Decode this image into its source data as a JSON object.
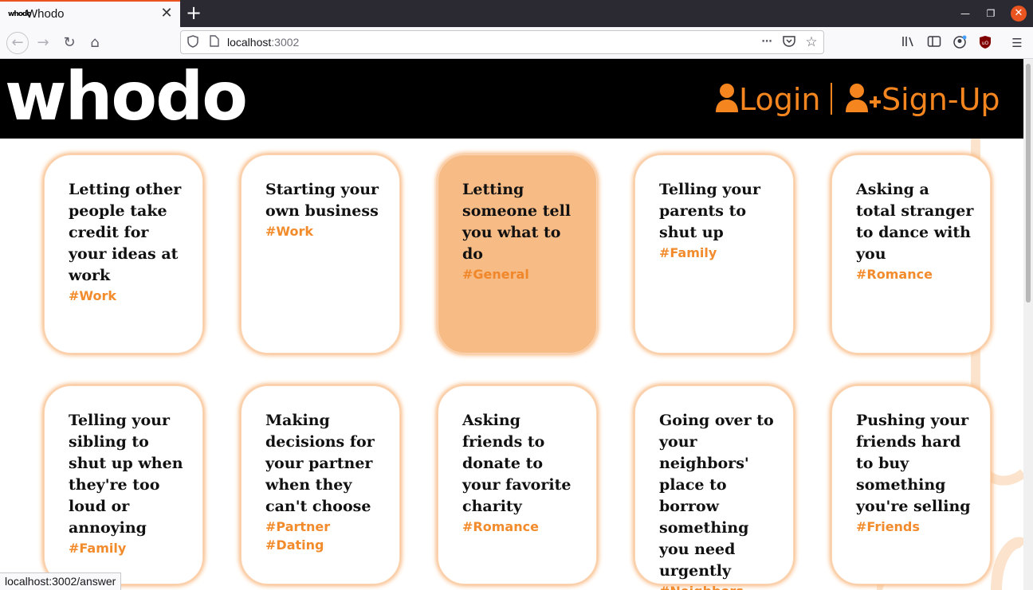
{
  "browser": {
    "tab_title": "Whodo",
    "tab_favicon": "whodo",
    "new_tab_symbol": "+",
    "tab_close_symbol": "✕",
    "url_host": "localhost",
    "url_port": ":3002",
    "status_url": "localhost:3002/answer"
  },
  "header": {
    "logo": "whodo",
    "login_label": "Login",
    "signup_label": "Sign-Up",
    "accent_color": "#f5861f"
  },
  "cards": [
    {
      "title": "Letting other people take credit for your ideas at work",
      "tags": [
        "#Work"
      ],
      "active": false
    },
    {
      "title": "Starting your own business",
      "tags": [
        "#Work"
      ],
      "active": false
    },
    {
      "title": "Letting someone tell you what to do",
      "tags": [
        "#General"
      ],
      "active": true
    },
    {
      "title": "Telling your parents to shut up",
      "tags": [
        "#Family"
      ],
      "active": false
    },
    {
      "title": "Asking a total stranger to dance with you",
      "tags": [
        "#Romance"
      ],
      "active": false
    },
    {
      "title": "Telling your sibling to shut up when they're too loud or annoying",
      "tags": [
        "#Family"
      ],
      "active": false
    },
    {
      "title": "Making decisions for your partner when they can't choose",
      "tags": [
        "#Partner",
        "#Dating"
      ],
      "active": false
    },
    {
      "title": "Asking friends to donate to your favorite charity",
      "tags": [
        "#Romance"
      ],
      "active": false
    },
    {
      "title": "Going over to your neighbors' place to borrow something you need urgently",
      "tags": [
        "#Neighbors"
      ],
      "active": false
    },
    {
      "title": "Pushing your friends hard to buy something you're selling",
      "tags": [
        "#Friends"
      ],
      "active": false
    }
  ]
}
